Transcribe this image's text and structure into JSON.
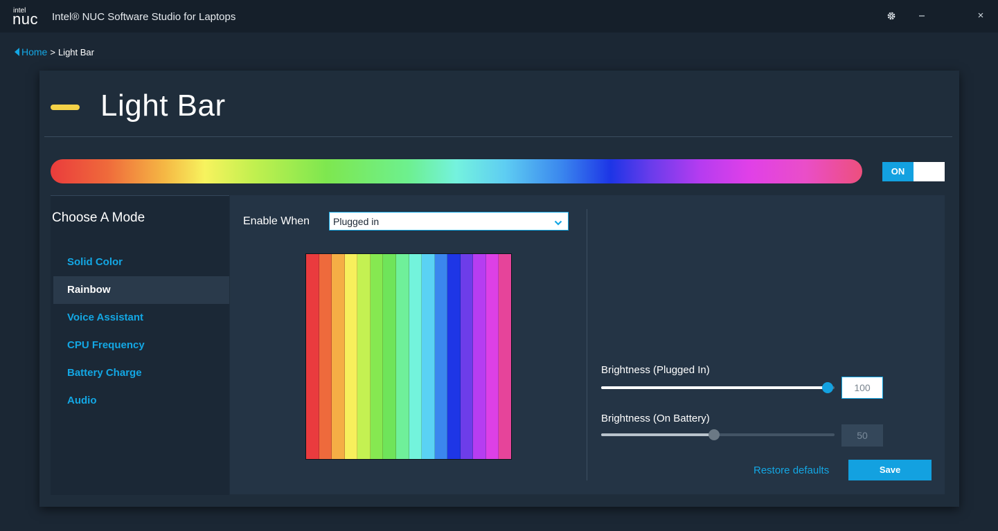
{
  "app": {
    "logo_small": "intel",
    "logo_big": "nuc",
    "title": "Intel® NUC Software Studio for Laptops"
  },
  "window_controls": [
    "settings-icon",
    "minimize-icon",
    "restore-icon",
    "close-icon"
  ],
  "breadcrumb": {
    "home": "Home",
    "separator": ">",
    "current": "Light Bar"
  },
  "page": {
    "title": "Light Bar",
    "accent_color": "#f4d247"
  },
  "toggle": {
    "label": "ON",
    "state": "on"
  },
  "modes": {
    "heading": "Choose A Mode",
    "items": [
      {
        "label": "Solid Color",
        "active": false
      },
      {
        "label": "Rainbow",
        "active": true
      },
      {
        "label": "Voice Assistant",
        "active": false
      },
      {
        "label": "CPU Frequency",
        "active": false
      },
      {
        "label": "Battery Charge",
        "active": false
      },
      {
        "label": "Audio",
        "active": false
      }
    ]
  },
  "enable_when": {
    "label": "Enable When",
    "value": "Plugged in"
  },
  "rainbow_colors": [
    "#ea3b3e",
    "#ee6a3c",
    "#f5ae45",
    "#f7ef5c",
    "#c4f152",
    "#86e851",
    "#6fe45a",
    "#6ff09a",
    "#73f3dc",
    "#5ad2f4",
    "#3b86ee",
    "#1e36e6",
    "#6d3de9",
    "#b63df1",
    "#dd40e6",
    "#e6449a"
  ],
  "brightness": {
    "plugged_in": {
      "label": "Brightness (Plugged In)",
      "value": "100",
      "level": 100,
      "enabled": true
    },
    "on_battery": {
      "label": "Brightness (On Battery)",
      "value": "50",
      "level": 50,
      "enabled": false
    }
  },
  "actions": {
    "restore": "Restore defaults",
    "save": "Save"
  },
  "colors": {
    "accent": "#13a1e0",
    "background": "#1b2734",
    "titlebar": "#151f2a"
  }
}
